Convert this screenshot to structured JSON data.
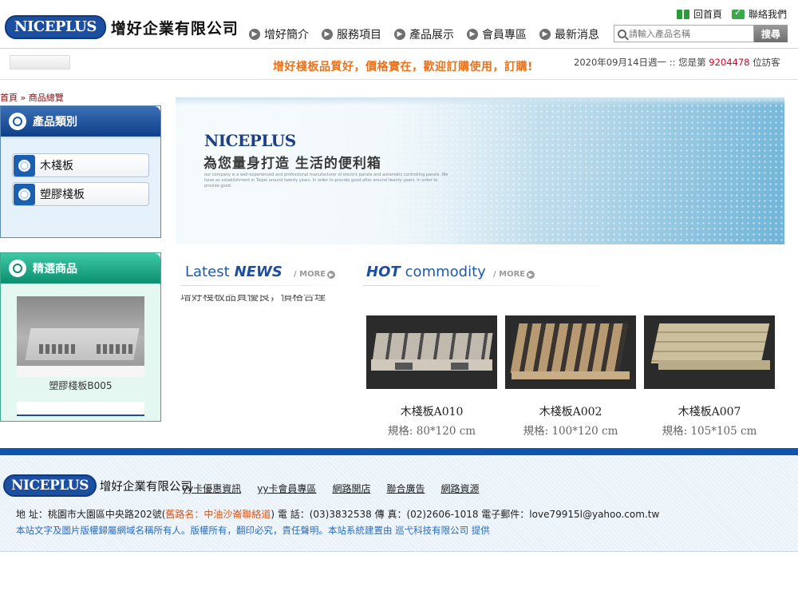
{
  "header": {
    "logo_mark": "NICEPLUS",
    "company_name": "增好企業有限公司",
    "top_links": {
      "home": "回首頁",
      "contact": "聯絡我們"
    },
    "nav": [
      "增好簡介",
      "服務項目",
      "產品展示",
      "會員專區",
      "最新消息"
    ],
    "search": {
      "placeholder": "請輸入產品名稱",
      "button": "搜尋"
    }
  },
  "marquee": "增好棧板品質好，價格實在，歡迎訂購使用，訂購!",
  "visit": {
    "date_prefix": "2020年09月14日週一 :: 您是第",
    "count": "9204478",
    "suffix": "位訪客"
  },
  "breadcrumb": {
    "home": "首頁",
    "sep": "»",
    "current": "商品總覽"
  },
  "sidebar": {
    "categories_title": "產品類別",
    "categories": [
      "木棧板",
      "塑膠棧板"
    ],
    "featured_title": "精選商品",
    "featured_caption": "塑膠棧板B005"
  },
  "banner": {
    "logo": "NICEPLUS",
    "slogan": "為您量身打造 生活的便利箱",
    "fine_print": "our company is a well-experienced and professional manufacturer of electric panels and automatic controlling panels. We have an establishment in Taipei around twenty years. In order to provide good after around twenty years, in order to provide good."
  },
  "tabs": {
    "news": {
      "light": "Latest",
      "bold": "NEWS",
      "more": "/ MORE"
    },
    "hot": {
      "bold": "HOT",
      "light": "commodity",
      "more": "/ MORE"
    },
    "news_ticker": "增好棧板品質優良，價格合理"
  },
  "products": [
    {
      "name": "木棧板A010",
      "spec": "規格: 80*120 cm"
    },
    {
      "name": "木棧板A002",
      "spec": "規格: 100*120 cm"
    },
    {
      "name": "木棧板A007",
      "spec": "規格: 105*105 cm"
    }
  ],
  "footer": {
    "logo_mark": "NICEPLUS",
    "company_name": "增好企業有限公司",
    "links": [
      "yy卡優惠資訊",
      "yy卡會員專區",
      "網路開店",
      "聯合廣告",
      "網路資源"
    ],
    "address_label": "地 址：桃園市大園區中央路202號(",
    "address_note": "舊路名：中油沙崙聯絡道",
    "contact_rest": ") 電 話：(03)3832538 傳 真：(02)2606-1018 電子郵件：love79915l@yahoo.com.tw",
    "copyright": "本站文字及圖片版權歸屬網域名稱所有人。版權所有，翻印必究，責任聲明。本站系統建置由 巡弋科技有限公司 提供"
  },
  "colors": {
    "brand_blue": "#1d4fa0",
    "accent_orange": "#e8731e",
    "footer_bar": "#0f55b0",
    "link_red": "#7a1212"
  }
}
